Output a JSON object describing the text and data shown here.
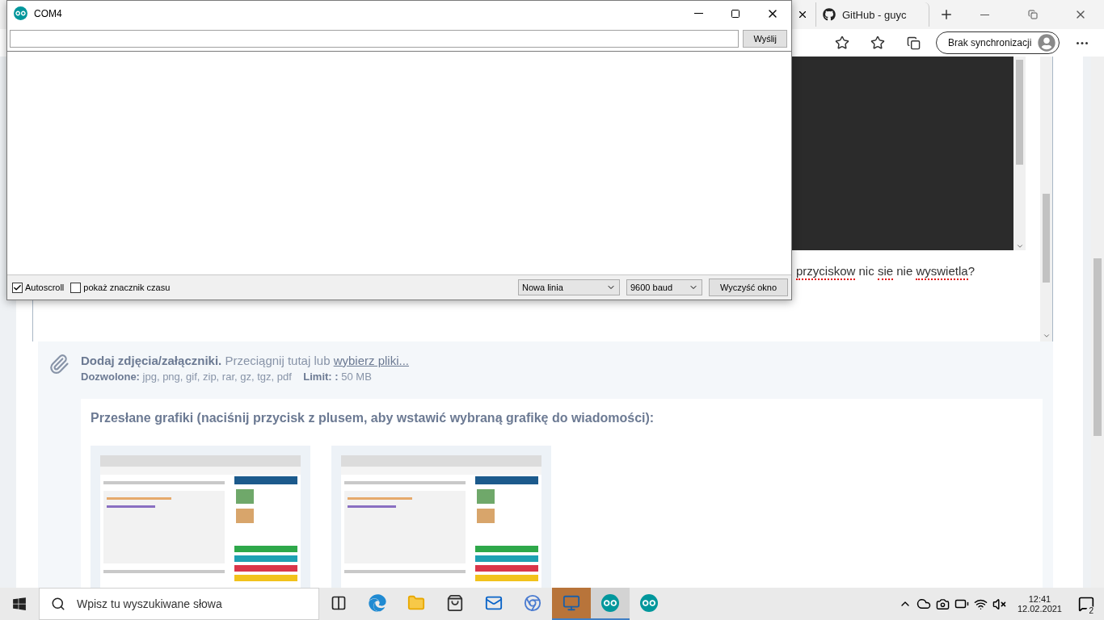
{
  "browser": {
    "tabs": [
      {
        "label": "GitHub - guyc",
        "selected": false
      }
    ],
    "sync_button": "Brak synchronizacji",
    "message_words": [
      {
        "text": "przyciskow",
        "misspelled": true
      },
      {
        "text": "nic",
        "misspelled": false
      },
      {
        "text": "sie",
        "misspelled": true
      },
      {
        "text": "nie",
        "misspelled": false
      },
      {
        "text": "wyswietla",
        "misspelled": true
      },
      {
        "text": "?",
        "misspelled": false
      }
    ],
    "attachments": {
      "title": "Dodaj zdjęcia/załączniki.",
      "hint": "Przeciągnij tutaj lub",
      "link": "wybierz pliki...",
      "allowed_label": "Dozwolone:",
      "allowed": "jpg, png, gif, zip, rar, gz, tgz, pdf",
      "limit_label": "Limit: :",
      "limit": "50 MB",
      "uploaded_title": "Przesłane grafiki (naciśnij przycisk z plusem, aby wstawić wybraną grafikę do wiadomości):"
    }
  },
  "serial_monitor": {
    "title": "COM4",
    "send_button": "Wyślij",
    "options": [
      {
        "label": "Autoscroll",
        "checked": true
      },
      {
        "label": "pokaż znacznik czasu",
        "checked": false
      }
    ],
    "line_ending": "Nowa linia",
    "baud": "9600 baud",
    "clear_button": "Wyczyść okno"
  },
  "taskbar": {
    "search": {
      "placeholder": "Wpisz tu wyszukiwane słowa"
    },
    "apps": [
      {
        "kind": "taskview",
        "active": false
      },
      {
        "kind": "edge",
        "active": false
      },
      {
        "kind": "explorer",
        "active": false
      },
      {
        "kind": "store",
        "active": false
      },
      {
        "kind": "mail",
        "active": false
      },
      {
        "kind": "chrome",
        "active": false
      },
      {
        "kind": "app",
        "active": true
      },
      {
        "kind": "arduino",
        "active": true
      },
      {
        "kind": "arduino",
        "active": false
      }
    ],
    "time": "12:41",
    "date": "12.02.2021",
    "notifications": "2"
  }
}
